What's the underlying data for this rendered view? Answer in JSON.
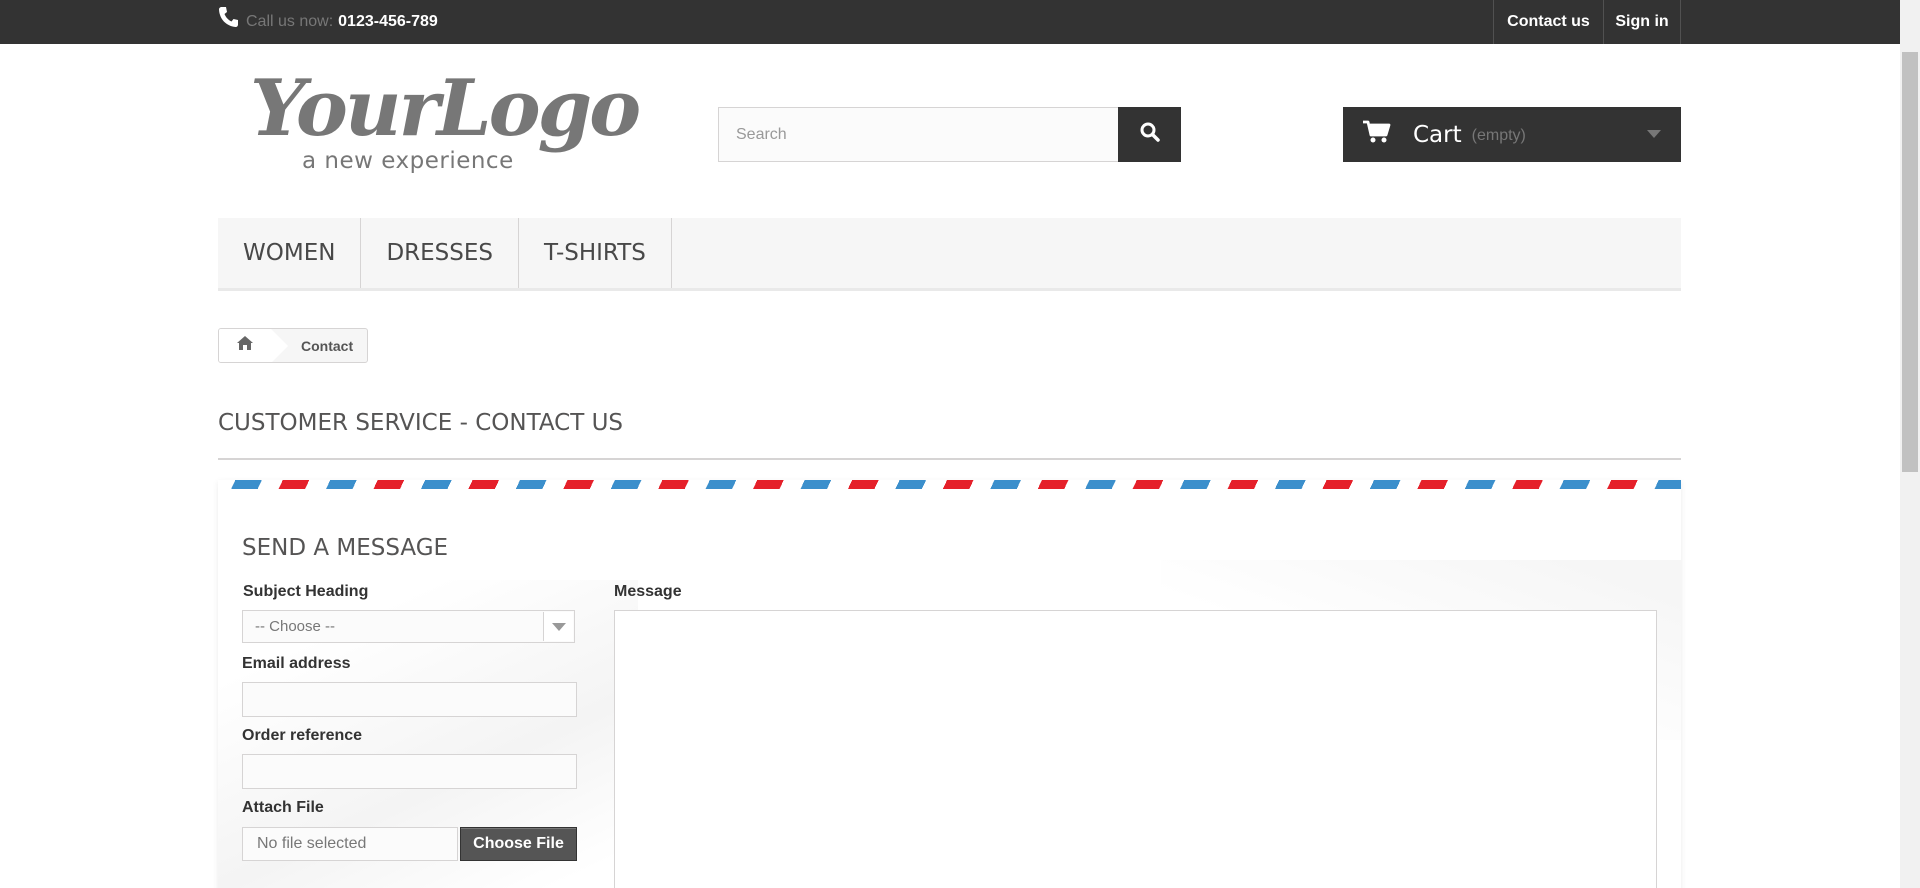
{
  "topbar": {
    "call_label": "Call us now:",
    "phone": "0123-456-789",
    "contact_label": "Contact us",
    "signin_label": "Sign in"
  },
  "logo": {
    "script": "YourLogo",
    "tagline": "a new experience"
  },
  "search": {
    "placeholder": "Search"
  },
  "cart": {
    "label": "Cart",
    "status": "(empty)"
  },
  "menu": {
    "items": [
      {
        "label": "WOMEN"
      },
      {
        "label": "DRESSES"
      },
      {
        "label": "T-SHIRTS"
      }
    ]
  },
  "breadcrumb": {
    "current": "Contact"
  },
  "page": {
    "heading": "CUSTOMER SERVICE - CONTACT US"
  },
  "form": {
    "title": "SEND A MESSAGE",
    "subject_label": "Subject Heading",
    "subject_value": "-- Choose --",
    "email_label": "Email address",
    "email_value": "",
    "order_label": "Order reference",
    "order_value": "",
    "attach_label": "Attach File",
    "file_status": "No file selected",
    "file_button": "Choose File",
    "message_label": "Message",
    "message_value": ""
  },
  "colors": {
    "topbar_bg": "#333333",
    "stripe_blue": "#3b8fcc",
    "stripe_red": "#e5202a"
  },
  "icons": {
    "phone": "phone-icon",
    "search": "search-icon",
    "cart": "cart-icon",
    "home": "home-icon",
    "dropdown": "chevron-down-icon"
  }
}
